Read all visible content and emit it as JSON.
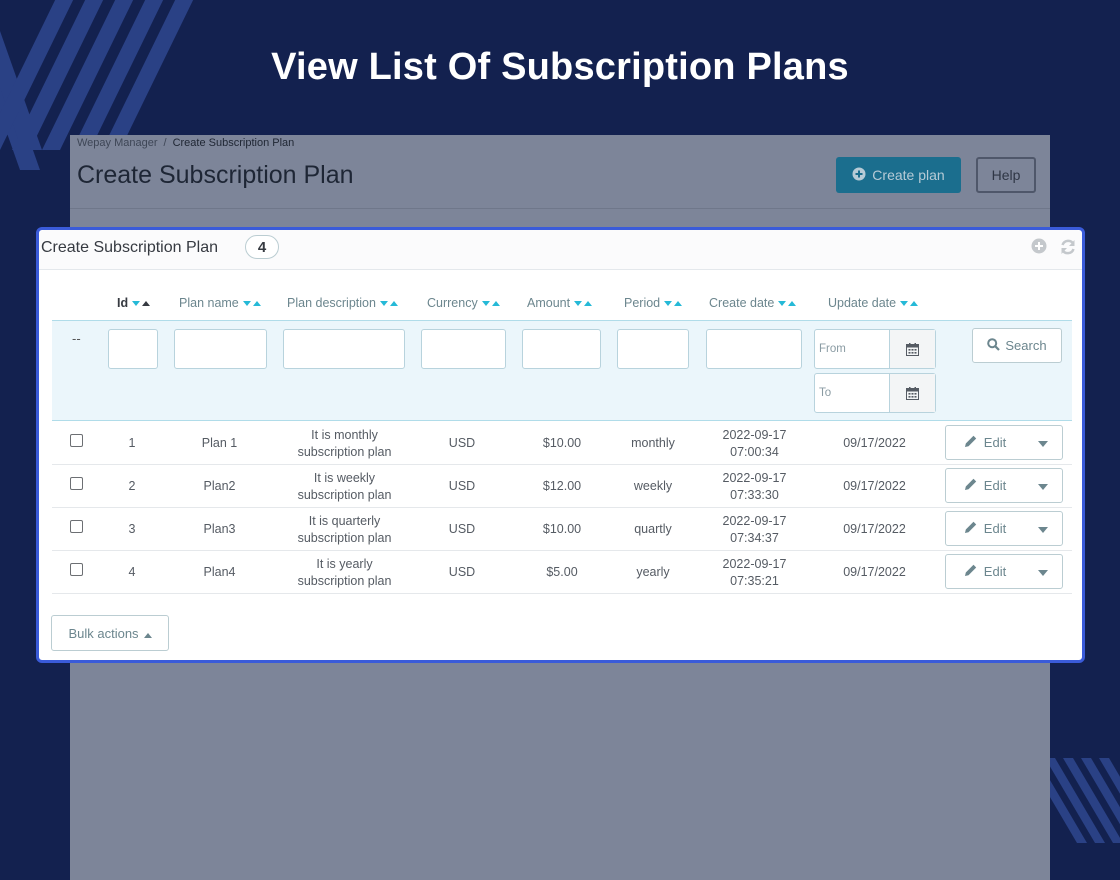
{
  "hero": {
    "title": "View List Of Subscription Plans"
  },
  "background_app": {
    "breadcrumb": [
      "Wepay Manager",
      "Create Subscription Plan"
    ],
    "page_title": "Create Subscription Plan",
    "create_button_label": "Create plan",
    "help_button_label": "Help"
  },
  "panel": {
    "title": "Create Subscription Plan",
    "count": "4",
    "columns": [
      {
        "key": "id",
        "label": "Id",
        "active": true
      },
      {
        "key": "plan_name",
        "label": "Plan name"
      },
      {
        "key": "plan_description",
        "label": "Plan description"
      },
      {
        "key": "currency",
        "label": "Currency"
      },
      {
        "key": "amount",
        "label": "Amount"
      },
      {
        "key": "period",
        "label": "Period"
      },
      {
        "key": "create_date",
        "label": "Create date"
      },
      {
        "key": "update_date",
        "label": "Update date"
      }
    ],
    "filters": {
      "dash": "--",
      "date_from_placeholder": "From",
      "date_to_placeholder": "To",
      "search_label": "Search"
    },
    "rows": [
      {
        "id": "1",
        "name": "Plan 1",
        "desc1": "It is monthly",
        "desc2": "subscription plan",
        "currency": "USD",
        "amount": "$10.00",
        "period": "monthly",
        "created_date": "2022-09-17",
        "created_time": "07:00:34",
        "updated": "09/17/2022",
        "edit": "Edit"
      },
      {
        "id": "2",
        "name": "Plan2",
        "desc1": "It is weekly",
        "desc2": "subscription plan",
        "currency": "USD",
        "amount": "$12.00",
        "period": "weekly",
        "created_date": "2022-09-17",
        "created_time": "07:33:30",
        "updated": "09/17/2022",
        "edit": "Edit"
      },
      {
        "id": "3",
        "name": "Plan3",
        "desc1": "It is quarterly",
        "desc2": "subscription plan",
        "currency": "USD",
        "amount": "$10.00",
        "period": "quartly",
        "created_date": "2022-09-17",
        "created_time": "07:34:37",
        "updated": "09/17/2022",
        "edit": "Edit"
      },
      {
        "id": "4",
        "name": "Plan4",
        "desc1": "It is yearly",
        "desc2": "subscription plan",
        "currency": "USD",
        "amount": "$5.00",
        "period": "yearly",
        "created_date": "2022-09-17",
        "created_time": "07:35:21",
        "updated": "09/17/2022",
        "edit": "Edit"
      }
    ],
    "bulk_actions_label": "Bulk actions"
  },
  "colors": {
    "page_background": "#13214f",
    "panel_border": "#3a5bd9",
    "accent_sort": "#25b9d7",
    "filter_row": "#ebf6fb"
  }
}
